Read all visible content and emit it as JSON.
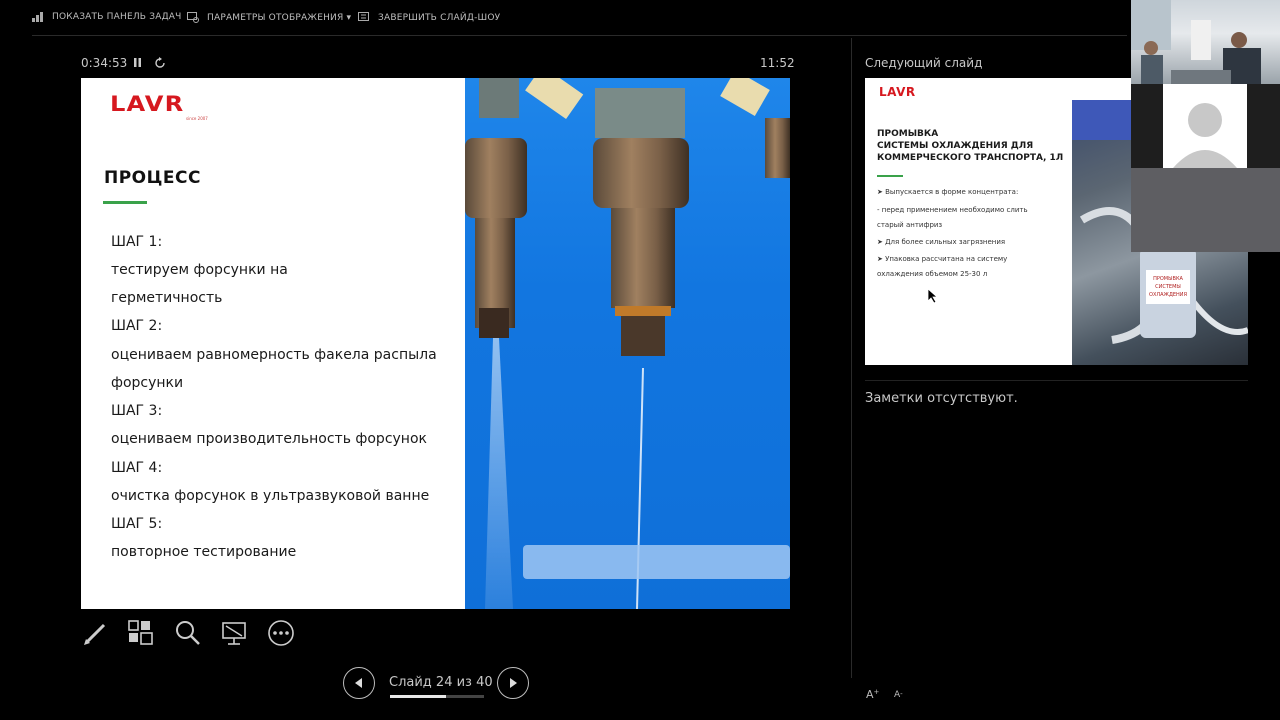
{
  "toolbar": {
    "taskbar_label": "ПОКАЗАТЬ ПАНЕЛЬ ЗАДАЧ",
    "display_settings_label": "ПАРАМЕТРЫ ОТОБРАЖЕНИЯ ▾",
    "end_show_label": "ЗАВЕРШИТЬ СЛАЙД-ШОУ"
  },
  "timer": {
    "elapsed": "0:34:53",
    "clock": "11:52"
  },
  "slide": {
    "logo": "LAVR",
    "logo_sub": "since 2007",
    "title": "ПРОЦЕСС",
    "lines": [
      "ШАГ 1:",
      "тестируем форсунки на",
      " герметичность",
      "ШАГ 2:",
      "оцениваем равномерность факела распыла",
      "форсунки",
      "ШАГ 3:",
      " оцениваем производительность форсунок",
      "ШАГ 4:",
      " очистка форсунок в ультразвуковой ванне",
      "ШАГ 5:",
      "повторное тестирование"
    ]
  },
  "navigation": {
    "counter": "Слайд 24 из 40",
    "progress": 0.6
  },
  "next_slide": {
    "label": "Следующий слайд",
    "logo": "LAVR",
    "title_lines": [
      "ПРОМЫВКА",
      "СИСТЕМЫ ОХЛАЖДЕНИЯ ДЛЯ",
      "КОММЕРЧЕСКОГО ТРАНСПОРТА, 1Л"
    ],
    "bullets": [
      "➤  Выпускается в форме концентрата:",
      "- перед применением необходимо слить",
      "старый антифриз",
      "➤  Для более сильных загрязнения",
      "➤  Упаковка  рассчитана   на     систему",
      "    охлаждения объемом  25-30 л"
    ],
    "product_label": [
      "ПРОМЫВКА",
      "СИСТЕМЫ",
      "ОХЛАЖДЕНИЯ"
    ]
  },
  "notes": {
    "text": "Заметки отсутствуют."
  },
  "font_controls": {
    "increase": "A",
    "decrease": "A"
  },
  "colors": {
    "brand_red": "#d6181f",
    "accent_green": "#3aa24a",
    "slide_blue": "#1276e0"
  }
}
